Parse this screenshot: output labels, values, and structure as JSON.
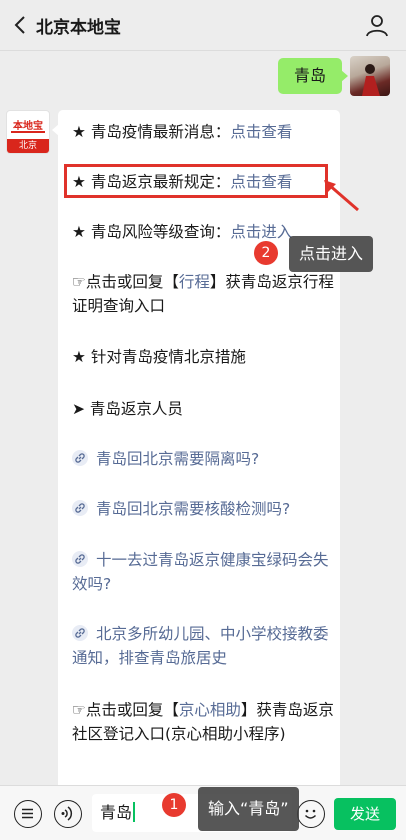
{
  "header": {
    "title": "北京本地宝"
  },
  "user_message": {
    "text": "青岛"
  },
  "bot": {
    "logo_top": "本地宝",
    "logo_bottom": "北京",
    "lines": [
      {
        "text": "★ 青岛疫情最新消息：",
        "link": "点击查看"
      },
      {
        "text": "★ 青岛返京最新规定：",
        "link": "点击查看"
      },
      {
        "text": "★ 青岛风险等级查询：",
        "link": "点击进入"
      },
      {
        "pre": "☞点击或回复【",
        "link": "行程",
        "post": "】获青岛返京行程证明查询入口"
      },
      {
        "text": "★ 针对青岛疫情北京措施"
      },
      {
        "text": "➤ 青岛返京人员"
      },
      {
        "link": "青岛回北京需要隔离吗?"
      },
      {
        "link": "青岛回北京需要核酸检测吗?"
      },
      {
        "link": "十一去过青岛返京健康宝绿码会失效吗?"
      },
      {
        "link": "北京多所幼儿园、中小学校接教委通知，排查青岛旅居史"
      },
      {
        "pre": "☞点击或回复【",
        "link": "京心相助",
        "post": "】获青岛返京社区登记入口(京心相助小程序)"
      }
    ]
  },
  "annotations": {
    "step2_badge": "2",
    "step2_tip": "点击进入",
    "step1_badge": "1",
    "step1_tip": "输入“青岛”"
  },
  "input_bar": {
    "value": "青岛",
    "send_label": "发送"
  },
  "colors": {
    "link": "#576b95",
    "bubble_green": "#95ec69",
    "send_green": "#07c160",
    "highlight_red": "#e0322a"
  }
}
